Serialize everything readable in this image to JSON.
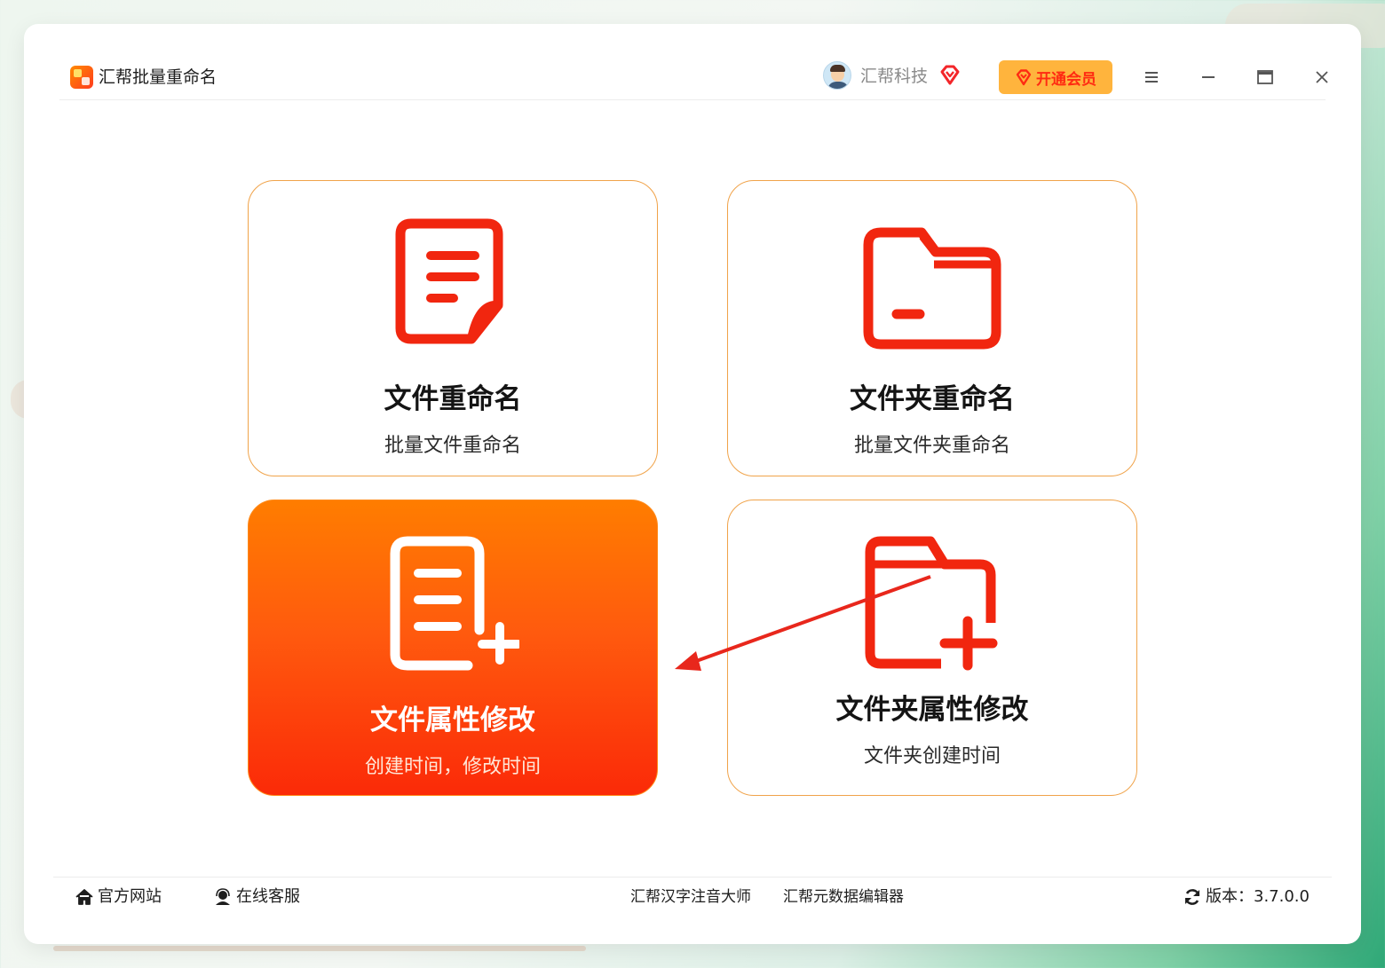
{
  "app": {
    "title": "汇帮批量重命名"
  },
  "user": {
    "name": "汇帮科技",
    "vip_button": "开通会员"
  },
  "window_controls": [
    "menu-icon",
    "minimize-icon",
    "maximize-icon",
    "close-icon"
  ],
  "cards": [
    {
      "id": "file-rename",
      "title": "文件重命名",
      "subtitle": "批量文件重命名",
      "icon": "document-icon",
      "active": false
    },
    {
      "id": "folder-rename",
      "title": "文件夹重命名",
      "subtitle": "批量文件夹重命名",
      "icon": "folder-icon",
      "active": false
    },
    {
      "id": "file-attr",
      "title": "文件属性修改",
      "subtitle": "创建时间，修改时间",
      "icon": "document-add-icon",
      "active": true
    },
    {
      "id": "folder-attr",
      "title": "文件夹属性修改",
      "subtitle": "文件夹创建时间",
      "icon": "folder-add-icon",
      "active": false
    }
  ],
  "footer": {
    "website": "官方网站",
    "support": "在线客服",
    "link1": "汇帮汉字注音大师",
    "link2": "汇帮元数据编辑器",
    "version": "版本：3.7.0.0"
  },
  "colors": {
    "accent": "#ff5a0e",
    "icon_red": "#f1260f",
    "card_border": "#f0a34a",
    "vip_bg": "#ffb43d"
  }
}
